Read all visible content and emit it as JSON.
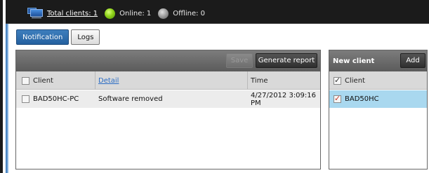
{
  "topbar": {
    "total_clients": "Total clients: 1",
    "online": "Online: 1",
    "offline": "Offline: 0"
  },
  "tabs": [
    {
      "label": "Notification",
      "active": true
    },
    {
      "label": "Logs",
      "active": false
    }
  ],
  "main": {
    "save_label": "Save",
    "generate_label": "Generate report",
    "columns": [
      "Client",
      "Detail",
      "Time"
    ],
    "rows": [
      {
        "client": "BAD50HC-PC",
        "detail": "Software removed",
        "time": "4/27/2012 3:09:16 PM"
      }
    ]
  },
  "side": {
    "title": "New client",
    "add_label": "Add",
    "column": "Client",
    "rows": [
      {
        "client": "BAD50HC",
        "checked": true
      }
    ]
  },
  "colors": {
    "accent_tab": "#2e6fb0",
    "selected_row": "#a9d8ef",
    "online": "#8ed119",
    "offline": "#9a9a9a"
  }
}
